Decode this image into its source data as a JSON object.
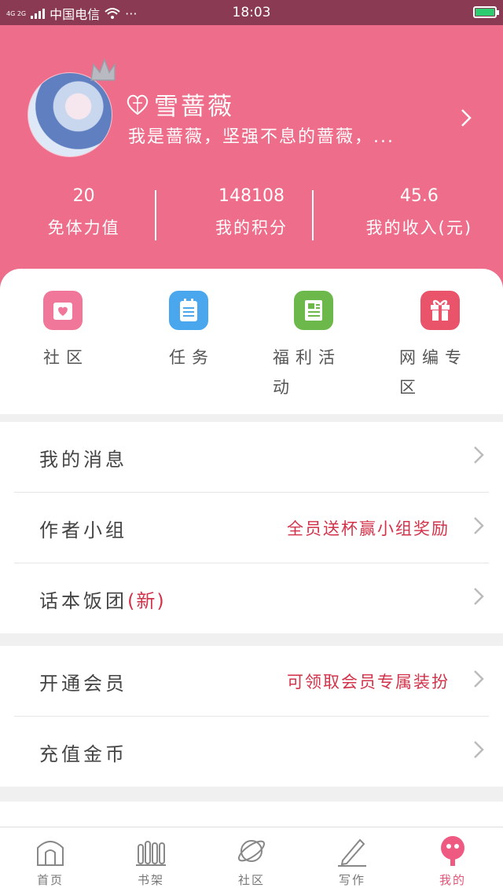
{
  "status_bar": {
    "network": "4G 2G",
    "carrier": "中国电信",
    "more": "···",
    "time": "18:03"
  },
  "profile": {
    "name": "雪蔷薇",
    "bio": "我是蔷薇，坚强不息的蔷薇，...",
    "stats": [
      {
        "value": "20",
        "label": "免体力值"
      },
      {
        "value": "148108",
        "label": "我的积分"
      },
      {
        "value": "45.6",
        "label": "我的收入(元)"
      }
    ]
  },
  "quick_actions": [
    {
      "label": "社区",
      "color": "#f0769a",
      "icon": "heart-card-icon"
    },
    {
      "label": "任务",
      "color": "#4aa7ee",
      "icon": "clipboard-icon"
    },
    {
      "label": "福利活动",
      "color": "#6cb84b",
      "icon": "document-icon"
    },
    {
      "label": "网编专区",
      "color": "#e9546b",
      "icon": "gift-icon"
    }
  ],
  "menu": {
    "group1": [
      {
        "label": "我的消息",
        "extra": ""
      },
      {
        "label": "作者小组",
        "extra": "全员送杯赢小组奖励"
      },
      {
        "label": "话本饭团",
        "badge": "(新)",
        "extra": ""
      }
    ],
    "group2": [
      {
        "label": "开通会员",
        "extra": "可领取会员专属装扮"
      },
      {
        "label": "充值金币",
        "extra": ""
      }
    ]
  },
  "tabs": [
    {
      "label": "首页",
      "icon": "home-icon"
    },
    {
      "label": "书架",
      "icon": "bookshelf-icon"
    },
    {
      "label": "社区",
      "icon": "planet-icon"
    },
    {
      "label": "写作",
      "icon": "pen-icon"
    },
    {
      "label": "我的",
      "icon": "profile-icon",
      "active": true
    }
  ],
  "colors": {
    "header_bg": "#ee6d8a",
    "accent": "#e25577",
    "highlight_text": "#d2334a"
  }
}
